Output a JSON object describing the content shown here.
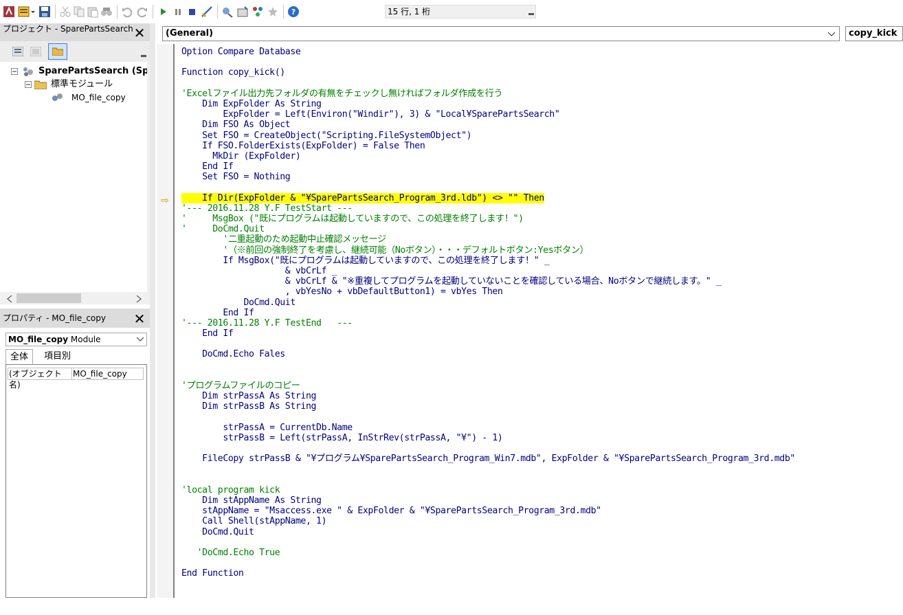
{
  "toolbar": {
    "status_text": "15 行, 1 桁",
    "icons": [
      "access-icon",
      "insert-module-icon",
      "save-icon",
      "cut-icon",
      "copy-icon",
      "paste-icon",
      "find-icon",
      "undo-icon",
      "redo-icon",
      "run-icon",
      "break-icon",
      "reset-icon",
      "design-mode-icon",
      "project-explorer-icon",
      "properties-icon",
      "object-browser-icon",
      "toolbox-icon",
      "help-icon"
    ]
  },
  "project": {
    "title": "プロジェクト - SparePartsSearch",
    "tree": {
      "root": "SparePartsSearch (Sp",
      "folder": "標準モジュール",
      "module": "MO_file_copy"
    }
  },
  "properties": {
    "title": "プロパティ - MO_file_copy",
    "object_name": "MO_file_copy",
    "object_type": "Module",
    "tabs": [
      "全体",
      "項目別"
    ],
    "row_key": "(オブジェクト名)",
    "row_value": "MO_file_copy"
  },
  "editor": {
    "object_combo": "(General)",
    "proc_combo": "copy_kick",
    "lines": [
      {
        "t": "Option Compare Database",
        "c": "code"
      },
      {
        "t": "",
        "c": "code"
      },
      {
        "t": "Function copy_kick()",
        "c": "code"
      },
      {
        "t": "",
        "c": "code"
      },
      {
        "t": "'Excelファイル出力先フォルダの有無をチェックし無ければフォルダ作成を行う",
        "c": "cm"
      },
      {
        "t": "    Dim ExpFolder As String",
        "c": "code"
      },
      {
        "t": "        ExpFolder = Left(Environ(\"Windir\"), 3) & \"Local¥SparePartsSearch\"",
        "c": "code"
      },
      {
        "t": "    Dim FSO As Object",
        "c": "code"
      },
      {
        "t": "    Set FSO = CreateObject(\"Scripting.FileSystemObject\")",
        "c": "code"
      },
      {
        "t": "    If FSO.FolderExists(ExpFolder) = False Then",
        "c": "code"
      },
      {
        "t": "      MkDir (ExpFolder)",
        "c": "code"
      },
      {
        "t": "    End If",
        "c": "code"
      },
      {
        "t": "    Set FSO = Nothing",
        "c": "code"
      },
      {
        "t": "",
        "c": "code"
      },
      {
        "t": "    If Dir(ExpFolder & \"¥SparePartsSearch_Program_3rd.ldb\") <> \"\" Then",
        "c": "hl"
      },
      {
        "t": "'--- 2016.11.28 Y.F TestStart ---",
        "c": "cm"
      },
      {
        "t": "'     MsgBox (\"既にプログラムは起動していますので、この処理を終了します！\")",
        "c": "cm"
      },
      {
        "t": "'     DoCmd.Quit",
        "c": "cm"
      },
      {
        "t": "        '二重起動のため起動中止確認メッセージ",
        "c": "cm"
      },
      {
        "t": "        '（※前回の強制終了を考慮し、継続可能（Noボタン）・・・デフォルトボタン:Yesボタン）",
        "c": "cm"
      },
      {
        "t": "        If MsgBox(\"既にプログラムは起動していますので、この処理を終了します！\" _",
        "c": "code"
      },
      {
        "t": "                    & vbCrLf _",
        "c": "code"
      },
      {
        "t": "                    & vbCrLf & \"※重複してプログラムを起動していないことを確認している場合、Noボタンで継続します。\" _",
        "c": "code"
      },
      {
        "t": "                    , vbYesNo + vbDefaultButton1) = vbYes Then",
        "c": "code"
      },
      {
        "t": "            DoCmd.Quit",
        "c": "code"
      },
      {
        "t": "        End If",
        "c": "code"
      },
      {
        "t": "'--- 2016.11.28 Y.F TestEnd   ---",
        "c": "cm"
      },
      {
        "t": "    End If",
        "c": "code"
      },
      {
        "t": "",
        "c": "code"
      },
      {
        "t": "    DoCmd.Echo Fales",
        "c": "code"
      },
      {
        "t": "",
        "c": "code"
      },
      {
        "t": "",
        "c": "code"
      },
      {
        "t": "'プログラムファイルのコピー",
        "c": "cm"
      },
      {
        "t": "    Dim strPassA As String",
        "c": "code"
      },
      {
        "t": "    Dim strPassB As String",
        "c": "code"
      },
      {
        "t": "",
        "c": "code"
      },
      {
        "t": "        strPassA = CurrentDb.Name",
        "c": "code"
      },
      {
        "t": "        strPassB = Left(strPassA, InStrRev(strPassA, \"¥\") - 1)",
        "c": "code"
      },
      {
        "t": "",
        "c": "code"
      },
      {
        "t": "    FileCopy strPassB & \"¥プログラム¥SparePartsSearch_Program_Win7.mdb\", ExpFolder & \"¥SparePartsSearch_Program_3rd.mdb\"",
        "c": "code"
      },
      {
        "t": "",
        "c": "code"
      },
      {
        "t": "",
        "c": "code"
      },
      {
        "t": "'local program kick",
        "c": "cm"
      },
      {
        "t": "    Dim stAppName As String",
        "c": "code"
      },
      {
        "t": "    stAppName = \"Msaccess.exe \" & ExpFolder & \"¥SparePartsSearch_Program_3rd.mdb\"",
        "c": "code"
      },
      {
        "t": "    Call Shell(stAppName, 1)",
        "c": "code"
      },
      {
        "t": "    DoCmd.Quit",
        "c": "code"
      },
      {
        "t": "",
        "c": "code"
      },
      {
        "t": "   'DoCmd.Echo True",
        "c": "cm"
      },
      {
        "t": "",
        "c": "code"
      },
      {
        "t": "End Function",
        "c": "code"
      }
    ]
  }
}
